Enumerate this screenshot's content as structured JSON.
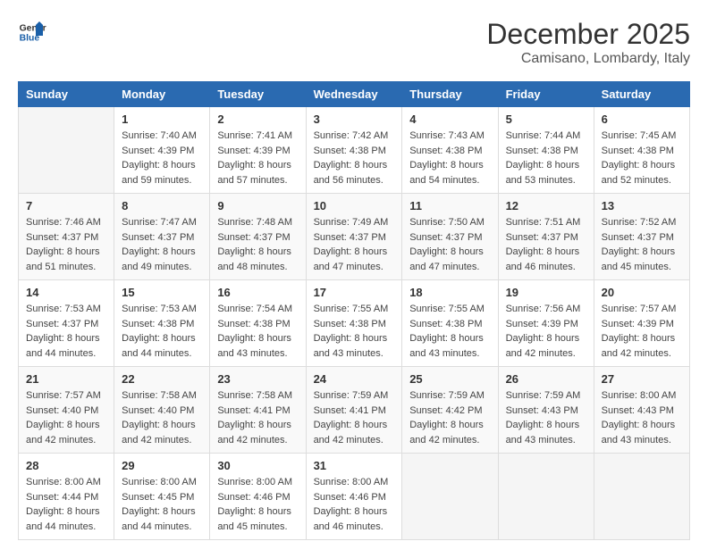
{
  "header": {
    "logo_line1": "General",
    "logo_line2": "Blue",
    "month": "December 2025",
    "location": "Camisano, Lombardy, Italy"
  },
  "weekdays": [
    "Sunday",
    "Monday",
    "Tuesday",
    "Wednesday",
    "Thursday",
    "Friday",
    "Saturday"
  ],
  "weeks": [
    [
      {
        "day": "",
        "info": ""
      },
      {
        "day": "1",
        "info": "Sunrise: 7:40 AM\nSunset: 4:39 PM\nDaylight: 8 hours\nand 59 minutes."
      },
      {
        "day": "2",
        "info": "Sunrise: 7:41 AM\nSunset: 4:39 PM\nDaylight: 8 hours\nand 57 minutes."
      },
      {
        "day": "3",
        "info": "Sunrise: 7:42 AM\nSunset: 4:38 PM\nDaylight: 8 hours\nand 56 minutes."
      },
      {
        "day": "4",
        "info": "Sunrise: 7:43 AM\nSunset: 4:38 PM\nDaylight: 8 hours\nand 54 minutes."
      },
      {
        "day": "5",
        "info": "Sunrise: 7:44 AM\nSunset: 4:38 PM\nDaylight: 8 hours\nand 53 minutes."
      },
      {
        "day": "6",
        "info": "Sunrise: 7:45 AM\nSunset: 4:38 PM\nDaylight: 8 hours\nand 52 minutes."
      }
    ],
    [
      {
        "day": "7",
        "info": "Sunrise: 7:46 AM\nSunset: 4:37 PM\nDaylight: 8 hours\nand 51 minutes."
      },
      {
        "day": "8",
        "info": "Sunrise: 7:47 AM\nSunset: 4:37 PM\nDaylight: 8 hours\nand 49 minutes."
      },
      {
        "day": "9",
        "info": "Sunrise: 7:48 AM\nSunset: 4:37 PM\nDaylight: 8 hours\nand 48 minutes."
      },
      {
        "day": "10",
        "info": "Sunrise: 7:49 AM\nSunset: 4:37 PM\nDaylight: 8 hours\nand 47 minutes."
      },
      {
        "day": "11",
        "info": "Sunrise: 7:50 AM\nSunset: 4:37 PM\nDaylight: 8 hours\nand 47 minutes."
      },
      {
        "day": "12",
        "info": "Sunrise: 7:51 AM\nSunset: 4:37 PM\nDaylight: 8 hours\nand 46 minutes."
      },
      {
        "day": "13",
        "info": "Sunrise: 7:52 AM\nSunset: 4:37 PM\nDaylight: 8 hours\nand 45 minutes."
      }
    ],
    [
      {
        "day": "14",
        "info": "Sunrise: 7:53 AM\nSunset: 4:37 PM\nDaylight: 8 hours\nand 44 minutes."
      },
      {
        "day": "15",
        "info": "Sunrise: 7:53 AM\nSunset: 4:38 PM\nDaylight: 8 hours\nand 44 minutes."
      },
      {
        "day": "16",
        "info": "Sunrise: 7:54 AM\nSunset: 4:38 PM\nDaylight: 8 hours\nand 43 minutes."
      },
      {
        "day": "17",
        "info": "Sunrise: 7:55 AM\nSunset: 4:38 PM\nDaylight: 8 hours\nand 43 minutes."
      },
      {
        "day": "18",
        "info": "Sunrise: 7:55 AM\nSunset: 4:38 PM\nDaylight: 8 hours\nand 43 minutes."
      },
      {
        "day": "19",
        "info": "Sunrise: 7:56 AM\nSunset: 4:39 PM\nDaylight: 8 hours\nand 42 minutes."
      },
      {
        "day": "20",
        "info": "Sunrise: 7:57 AM\nSunset: 4:39 PM\nDaylight: 8 hours\nand 42 minutes."
      }
    ],
    [
      {
        "day": "21",
        "info": "Sunrise: 7:57 AM\nSunset: 4:40 PM\nDaylight: 8 hours\nand 42 minutes."
      },
      {
        "day": "22",
        "info": "Sunrise: 7:58 AM\nSunset: 4:40 PM\nDaylight: 8 hours\nand 42 minutes."
      },
      {
        "day": "23",
        "info": "Sunrise: 7:58 AM\nSunset: 4:41 PM\nDaylight: 8 hours\nand 42 minutes."
      },
      {
        "day": "24",
        "info": "Sunrise: 7:59 AM\nSunset: 4:41 PM\nDaylight: 8 hours\nand 42 minutes."
      },
      {
        "day": "25",
        "info": "Sunrise: 7:59 AM\nSunset: 4:42 PM\nDaylight: 8 hours\nand 42 minutes."
      },
      {
        "day": "26",
        "info": "Sunrise: 7:59 AM\nSunset: 4:43 PM\nDaylight: 8 hours\nand 43 minutes."
      },
      {
        "day": "27",
        "info": "Sunrise: 8:00 AM\nSunset: 4:43 PM\nDaylight: 8 hours\nand 43 minutes."
      }
    ],
    [
      {
        "day": "28",
        "info": "Sunrise: 8:00 AM\nSunset: 4:44 PM\nDaylight: 8 hours\nand 44 minutes."
      },
      {
        "day": "29",
        "info": "Sunrise: 8:00 AM\nSunset: 4:45 PM\nDaylight: 8 hours\nand 44 minutes."
      },
      {
        "day": "30",
        "info": "Sunrise: 8:00 AM\nSunset: 4:46 PM\nDaylight: 8 hours\nand 45 minutes."
      },
      {
        "day": "31",
        "info": "Sunrise: 8:00 AM\nSunset: 4:46 PM\nDaylight: 8 hours\nand 46 minutes."
      },
      {
        "day": "",
        "info": ""
      },
      {
        "day": "",
        "info": ""
      },
      {
        "day": "",
        "info": ""
      }
    ]
  ]
}
